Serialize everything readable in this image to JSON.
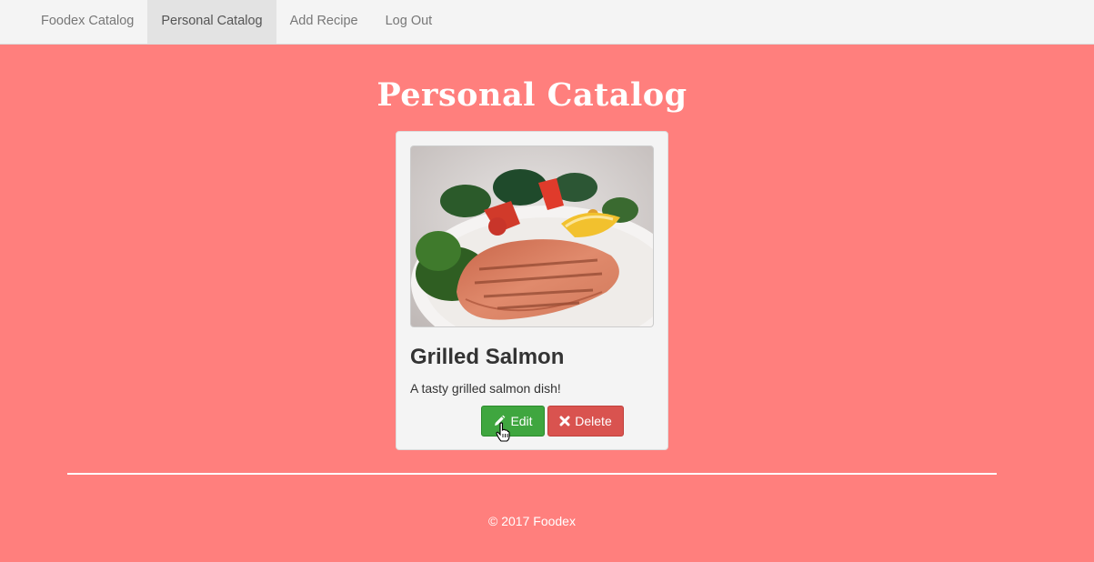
{
  "navbar": {
    "items": [
      {
        "label": "Foodex Catalog",
        "active": false
      },
      {
        "label": "Personal Catalog",
        "active": true
      },
      {
        "label": "Add Recipe",
        "active": false
      },
      {
        "label": "Log Out",
        "active": false
      }
    ]
  },
  "page": {
    "title": "Personal Catalog",
    "background_color": "#ff7f7d"
  },
  "recipe_card": {
    "image_subject": "grilled salmon fillet with salad on a white plate",
    "title": "Grilled Salmon",
    "description": "A tasty grilled salmon dish!",
    "edit_label": "Edit",
    "edit_icon": "pencil-icon",
    "delete_label": "Delete",
    "delete_icon": "close-icon",
    "edit_color": "#3fa63f",
    "delete_color": "#d9534f"
  },
  "footer": {
    "copyright": "© 2017 Foodex"
  }
}
